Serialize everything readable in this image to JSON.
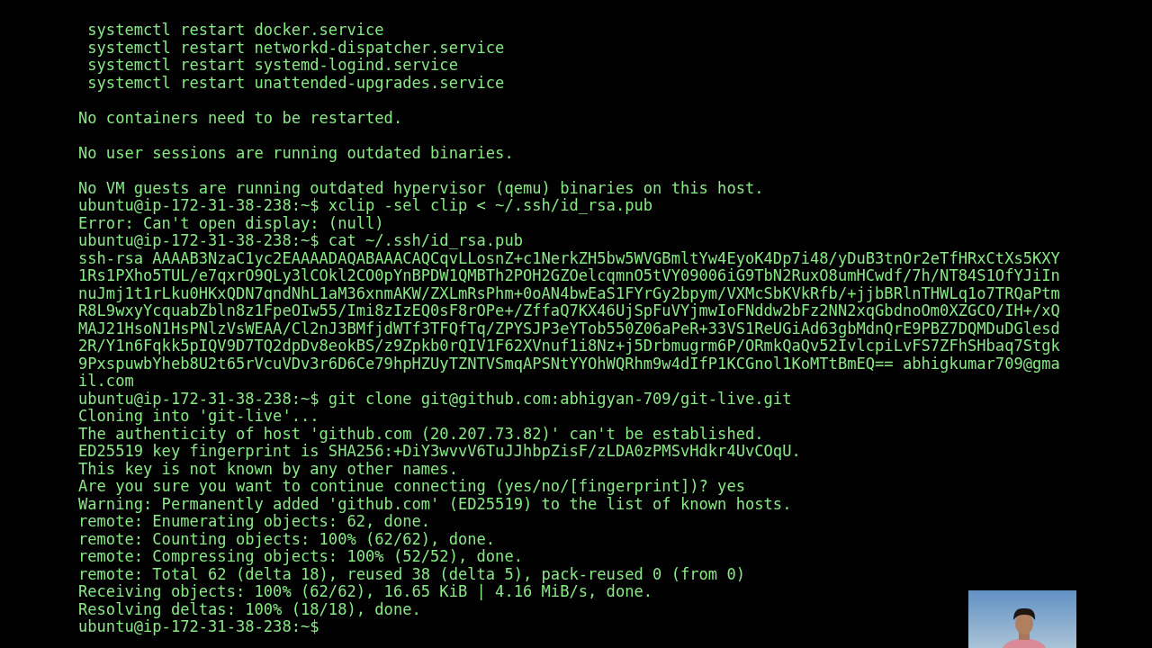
{
  "terminal": {
    "lines": [
      {
        "kind": "output",
        "text": " systemctl restart docker.service"
      },
      {
        "kind": "output",
        "text": " systemctl restart networkd-dispatcher.service"
      },
      {
        "kind": "output",
        "text": " systemctl restart systemd-logind.service"
      },
      {
        "kind": "output",
        "text": " systemctl restart unattended-upgrades.service"
      },
      {
        "kind": "blank"
      },
      {
        "kind": "output",
        "text": "No containers need to be restarted."
      },
      {
        "kind": "blank"
      },
      {
        "kind": "output",
        "text": "No user sessions are running outdated binaries."
      },
      {
        "kind": "blank"
      },
      {
        "kind": "output",
        "text": "No VM guests are running outdated hypervisor (qemu) binaries on this host."
      },
      {
        "kind": "prompt",
        "prompt": "ubuntu@ip-172-31-38-238:~$",
        "command": "xclip -sel clip < ~/.ssh/id_rsa.pub"
      },
      {
        "kind": "output",
        "text": "Error: Can't open display: (null)"
      },
      {
        "kind": "prompt",
        "prompt": "ubuntu@ip-172-31-38-238:~$",
        "command": "cat ~/.ssh/id_rsa.pub"
      },
      {
        "kind": "output",
        "text": "ssh-rsa AAAAB3NzaC1yc2EAAAADAQABAAACAQCqvLLosnZ+c1NerkZH5bw5WVGBmltYw4EyoK4Dp7i48/yDuB3tnOr2eTfHRxCtXs5KXY"
      },
      {
        "kind": "output",
        "text": "1Rs1PXho5TUL/e7qxrO9QLy3lCOkl2CO0pYnBPDW1QMBTh2POH2GZOelcqmnO5tVY09006iG9TbN2RuxO8umHCwdf/7h/NT84S1OfYJiIn"
      },
      {
        "kind": "output",
        "text": "nuJmj1t1rLku0HKxQDN7qndNhL1aM36xnmAKW/ZXLmRsPhm+0oAN4bwEaS1FYrGy2bpym/VXMcSbKVkRfb/+jjbBRlnTHWLq1o7TRQaPtm"
      },
      {
        "kind": "output",
        "text": "R8L9wxyYcquabZbln8z1FpeOIw55/Imi8zIzEQ0sF8rOPe+/ZffaQ7KX46UjSpFuVYjmwIoFNddw2bFz2NN2xqGbdnoOm0XZGCO/IH+/xQ"
      },
      {
        "kind": "output",
        "text": "MAJ21HsoN1HsPNlzVsWEAA/Cl2nJ3BMfjdWTf3TFQfTq/ZPYSJP3eYTob550Z06aPeR+33VS1ReUGiAd63gbMdnQrE9PBZ7DQMDuDGlesd"
      },
      {
        "kind": "output",
        "text": "2R/Y1n6Fqkk5pIQV9D7TQ2dpDv8eokBS/z9Zpkb0rQIV1F62XVnuf1i8Nz+j5Drbmugrm6P/ORmkQaQv52IvlcpiLvFS7ZFhSHbaq7Stgk"
      },
      {
        "kind": "output",
        "text": "9PxspuwbYheb8U2t65rVcuVDv3r6D6Ce79hpHZUyTZNTVSmqAPSNtYYOhWQRhm9w4dIfP1KCGnol1KoMTtBmEQ== abhigkumar709@gma"
      },
      {
        "kind": "output",
        "text": "il.com"
      },
      {
        "kind": "prompt",
        "prompt": "ubuntu@ip-172-31-38-238:~$",
        "command": "git clone git@github.com:abhigyan-709/git-live.git"
      },
      {
        "kind": "output",
        "text": "Cloning into 'git-live'..."
      },
      {
        "kind": "output",
        "text": "The authenticity of host 'github.com (20.207.73.82)' can't be established."
      },
      {
        "kind": "output",
        "text": "ED25519 key fingerprint is SHA256:+DiY3wvvV6TuJJhbpZisF/zLDA0zPMSvHdkr4UvCOqU."
      },
      {
        "kind": "output",
        "text": "This key is not known by any other names."
      },
      {
        "kind": "output",
        "text": "Are you sure you want to continue connecting (yes/no/[fingerprint])? yes"
      },
      {
        "kind": "output",
        "text": "Warning: Permanently added 'github.com' (ED25519) to the list of known hosts."
      },
      {
        "kind": "output",
        "text": "remote: Enumerating objects: 62, done."
      },
      {
        "kind": "output",
        "text": "remote: Counting objects: 100% (62/62), done."
      },
      {
        "kind": "output",
        "text": "remote: Compressing objects: 100% (52/52), done."
      },
      {
        "kind": "output",
        "text": "remote: Total 62 (delta 18), reused 38 (delta 5), pack-reused 0 (from 0)"
      },
      {
        "kind": "output",
        "text": "Receiving objects: 100% (62/62), 16.65 KiB | 4.16 MiB/s, done."
      },
      {
        "kind": "output",
        "text": "Resolving deltas: 100% (18/18), done."
      },
      {
        "kind": "prompt",
        "prompt": "ubuntu@ip-172-31-38-238:~$"
      }
    ]
  }
}
